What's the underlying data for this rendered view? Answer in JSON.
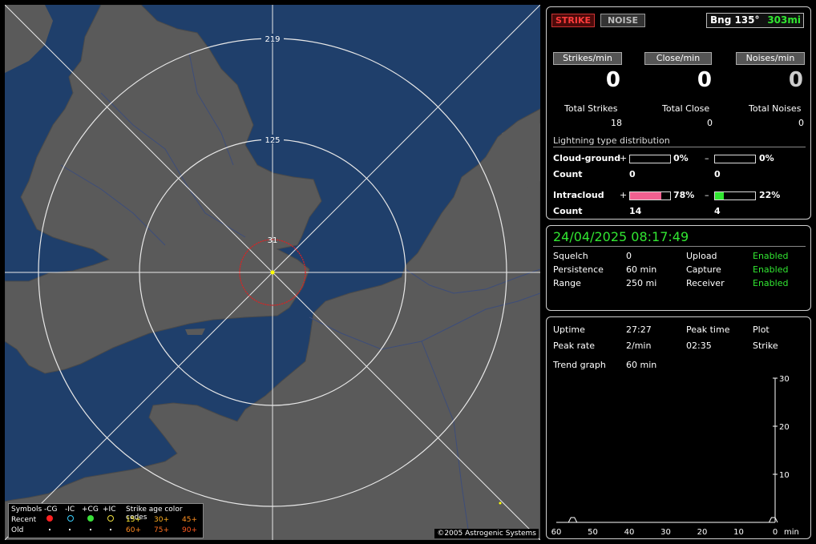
{
  "map": {
    "range_labels": [
      "219",
      "125",
      "31"
    ],
    "legend": {
      "symbols_label": "Symbols",
      "type_headers": [
        "-CG",
        "-IC",
        "+CG",
        "+IC"
      ],
      "row_recent": "Recent",
      "row_old": "Old",
      "age_title": "Strike age color codes",
      "recent_ages": [
        "15+",
        "30+",
        "45+"
      ],
      "old_ages": [
        "60+",
        "75+",
        "90+"
      ]
    },
    "copyright": "©2005 Astrogenic Systems",
    "colors": {
      "land": "#5a5a5a",
      "sea": "#1f3f6b",
      "rings": "#e0e0e0",
      "close_ring": "#e02020"
    }
  },
  "header": {
    "strike_button": "STRIKE",
    "noise_button": "NOISE",
    "bearing_label": "Bng 135°",
    "distance": "303mi"
  },
  "rates": [
    {
      "button": "Strikes/min",
      "value": "0",
      "total_label": "Total Strikes",
      "total": "18"
    },
    {
      "button": "Close/min",
      "value": "0",
      "total_label": "Total Close",
      "total": "0"
    },
    {
      "button": "Noises/min",
      "value": "0",
      "total_label": "Total Noises",
      "total": "0"
    }
  ],
  "distribution": {
    "title": "Lightning type distribution",
    "cloud_ground": {
      "label": "Cloud-ground",
      "plus_pct": "0%",
      "minus_pct": "0%",
      "count_label": "Count",
      "plus_count": "0",
      "minus_count": "0",
      "plus_fraction": 0,
      "minus_fraction": 0
    },
    "intracloud": {
      "label": "Intracloud",
      "plus_pct": "78%",
      "minus_pct": "22%",
      "count_label": "Count",
      "plus_count": "14",
      "minus_count": "4",
      "plus_fraction": 0.78,
      "minus_fraction": 0.22
    },
    "plus_sign": "+",
    "minus_sign": "–"
  },
  "status": {
    "datetime": "24/04/2025 08:17:49",
    "squelch_label": "Squelch",
    "squelch": "0",
    "persistence_label": "Persistence",
    "persistence": "60 min",
    "range_label": "Range",
    "range": "250 mi",
    "upload_label": "Upload",
    "upload": "Enabled",
    "capture_label": "Capture",
    "capture": "Enabled",
    "receiver_label": "Receiver",
    "receiver": "Enabled"
  },
  "stats": {
    "uptime_label": "Uptime",
    "uptime": "27:27",
    "peak_time_label": "Peak time",
    "peak_time": "02:35",
    "plot_label": "Plot",
    "plot": "Strike",
    "peak_rate_label": "Peak rate",
    "peak_rate": "2/min",
    "trend_label": "Trend graph",
    "trend": "60 min"
  },
  "chart_data": {
    "type": "line",
    "x_ticks": [
      "60",
      "50",
      "40",
      "30",
      "20",
      "10",
      "0"
    ],
    "x_unit": "min",
    "y_ticks": [
      "30",
      "20",
      "10"
    ],
    "xlim": [
      60,
      0
    ],
    "ylim": [
      0,
      30
    ],
    "series": [
      {
        "x": [
          56,
          55,
          1,
          0
        ],
        "y": [
          1,
          1,
          1,
          1
        ]
      }
    ]
  }
}
